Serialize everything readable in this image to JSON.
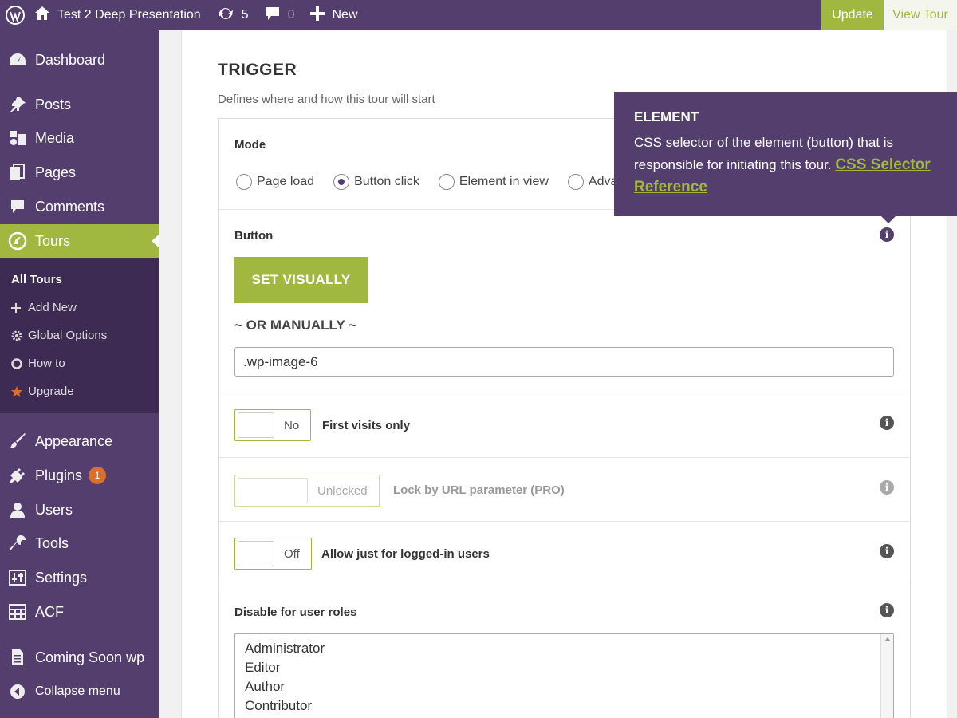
{
  "adminbar": {
    "site_name": "Test 2 Deep Presentation",
    "updates_count": "5",
    "comments_count": "0",
    "new_label": "New",
    "update_label": "Update",
    "view_tour_label": "View Tour"
  },
  "sidebar": {
    "items": [
      {
        "label": "Dashboard",
        "icon": "dashboard-icon"
      },
      {
        "label": "Posts",
        "icon": "pin-icon"
      },
      {
        "label": "Media",
        "icon": "media-icon"
      },
      {
        "label": "Pages",
        "icon": "pages-icon"
      },
      {
        "label": "Comments",
        "icon": "comment-icon"
      },
      {
        "label": "Tours",
        "icon": "tours-icon"
      },
      {
        "label": "Appearance",
        "icon": "brush-icon"
      },
      {
        "label": "Plugins",
        "icon": "plugin-icon",
        "badge": "1"
      },
      {
        "label": "Users",
        "icon": "user-icon"
      },
      {
        "label": "Tools",
        "icon": "wrench-icon"
      },
      {
        "label": "Settings",
        "icon": "settings-icon"
      },
      {
        "label": "ACF",
        "icon": "acf-icon"
      },
      {
        "label": "Coming Soon wp",
        "icon": "document-icon"
      },
      {
        "label": "Collapse menu",
        "icon": "collapse-icon"
      }
    ],
    "submenu": [
      {
        "label": "All Tours"
      },
      {
        "label": "Add New",
        "icon": "plus-icon"
      },
      {
        "label": "Global Options",
        "icon": "gear-icon"
      },
      {
        "label": "How to",
        "icon": "lifebuoy-icon"
      },
      {
        "label": "Upgrade",
        "icon": "star-icon"
      }
    ]
  },
  "trigger": {
    "title": "TRIGGER",
    "description": "Defines where and how this tour will start",
    "mode_label": "Mode",
    "mode_options": [
      "Page load",
      "Button click",
      "Element in view",
      "Adva"
    ],
    "mode_selected": "Button click",
    "button_label": "Button",
    "set_visually": "SET VISUALLY",
    "or_manually": "~ OR MANUALLY ~",
    "selector_value": ".wp-image-6",
    "first_visits": {
      "state": "No",
      "label": "First visits only"
    },
    "lock_url": {
      "state": "Unlocked",
      "label": "Lock by URL parameter (PRO)"
    },
    "logged_in": {
      "state": "Off",
      "label": "Allow just for logged-in users"
    },
    "roles_label": "Disable for user roles",
    "roles": [
      "Administrator",
      "Editor",
      "Author",
      "Contributor"
    ]
  },
  "tooltip": {
    "title": "ELEMENT",
    "body": "CSS selector of the element (button) that is responsible for initiating this tour.",
    "link": "CSS Selector Reference"
  },
  "colors": {
    "brand_purple": "#533e6e",
    "accent_green": "#a0b840",
    "badge_orange": "#d96f2a"
  }
}
